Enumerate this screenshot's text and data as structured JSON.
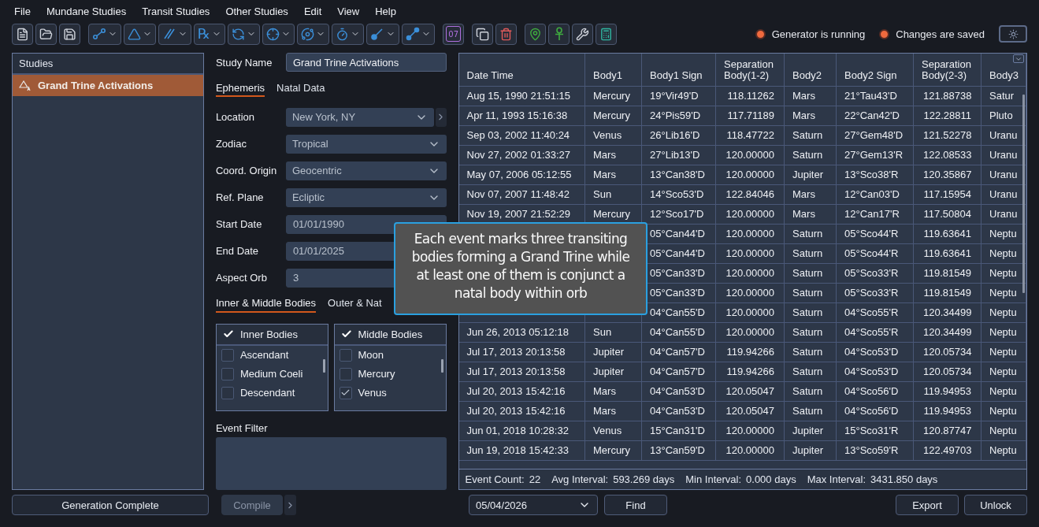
{
  "menu": [
    "File",
    "Mundane Studies",
    "Transit Studies",
    "Other Studies",
    "Edit",
    "View",
    "Help"
  ],
  "toolbar": [
    [
      {
        "kind": "plain"
      },
      {
        "kind": "plain"
      },
      {
        "kind": "plain"
      }
    ],
    [
      {
        "kind": "dropdown"
      },
      {
        "kind": "dropdown"
      },
      {
        "kind": "dropdown"
      },
      {
        "kind": "dropdown",
        "glyph": "℞"
      },
      {
        "kind": "dropdown"
      },
      {
        "kind": "dropdown"
      },
      {
        "kind": "dropdown"
      },
      {
        "kind": "dropdown"
      },
      {
        "kind": "dropdown"
      },
      {
        "kind": "dropdown"
      }
    ],
    [
      {
        "kind": "plain",
        "glyph": "07"
      }
    ],
    [
      {
        "kind": "plain"
      },
      {
        "kind": "plain"
      }
    ],
    [
      {
        "kind": "plain"
      },
      {
        "kind": "plain"
      },
      {
        "kind": "plain"
      },
      {
        "kind": "plain"
      }
    ]
  ],
  "indicators": [
    {
      "label": "Generator is running",
      "on": true
    },
    {
      "label": "Changes are saved",
      "on": true
    }
  ],
  "studies": {
    "title": "Studies",
    "items": [
      {
        "label": "Grand Trine Activations",
        "selected": true
      }
    ]
  },
  "study_name": {
    "label": "Study Name",
    "value": "Grand Trine Activations"
  },
  "tabs": [
    {
      "label": "Ephemeris",
      "selected": true
    },
    {
      "label": "Natal Data",
      "selected": false
    }
  ],
  "fields": [
    {
      "kind": "select",
      "label": "Location",
      "value": "New York, NY",
      "more": true
    },
    {
      "kind": "select",
      "label": "Zodiac",
      "value": "Tropical"
    },
    {
      "kind": "select",
      "label": "Coord. Origin",
      "value": "Geocentric"
    },
    {
      "kind": "select",
      "label": "Ref. Plane",
      "value": "Ecliptic"
    },
    {
      "kind": "text",
      "label": "Start Date",
      "value": "01/01/1990"
    },
    {
      "kind": "text",
      "label": "End Date",
      "value": "01/01/2025"
    },
    {
      "kind": "text",
      "label": "Aspect Orb",
      "value": "3"
    }
  ],
  "body_tabs": [
    {
      "label": "Inner & Middle Bodies",
      "selected": true
    },
    {
      "label": "Outer & Nat",
      "selected": false
    }
  ],
  "body_lists": [
    {
      "title": "Inner Bodies",
      "checked": true,
      "items": [
        {
          "label": "Ascendant",
          "checked": false
        },
        {
          "label": "Medium Coeli",
          "checked": false
        },
        {
          "label": "Descendant",
          "checked": false
        }
      ]
    },
    {
      "title": "Middle Bodies",
      "checked": true,
      "items": [
        {
          "label": "Moon",
          "checked": false
        },
        {
          "label": "Mercury",
          "checked": false
        },
        {
          "label": "Venus",
          "checked": true
        }
      ]
    }
  ],
  "event_filter": {
    "label": "Event Filter"
  },
  "table": {
    "columns": [
      "Date Time",
      "Body1",
      "Body1 Sign",
      "Separation Body(1-2)",
      "Body2",
      "Body2 Sign",
      "Separation Body(2-3)",
      "Body3"
    ],
    "rows": [
      [
        "Aug 15, 1990 21:51:15",
        "Mercury",
        "19°Vir49'D",
        "118.11262",
        "Mars",
        "21°Tau43'D",
        "121.88738",
        "Satur"
      ],
      [
        "Apr 11, 1993 15:16:38",
        "Mercury",
        "24°Pis59'D",
        "117.71189",
        "Mars",
        "22°Can42'D",
        "122.28811",
        "Pluto"
      ],
      [
        "Sep 03, 2002 11:40:24",
        "Venus",
        "26°Lib16'D",
        "118.47722",
        "Saturn",
        "27°Gem48'D",
        "121.52278",
        "Uranu"
      ],
      [
        "Nov 27, 2002 01:33:27",
        "Mars",
        "27°Lib13'D",
        "120.00000",
        "Saturn",
        "27°Gem13'R",
        "122.08533",
        "Uranu"
      ],
      [
        "May 07, 2006 05:12:55",
        "Mars",
        "13°Can38'D",
        "120.00000",
        "Jupiter",
        "13°Sco38'R",
        "120.35867",
        "Uranu"
      ],
      [
        "Nov 07, 2007 11:48:42",
        "Sun",
        "14°Sco53'D",
        "122.84046",
        "Mars",
        "12°Can03'D",
        "117.15954",
        "Uranu"
      ],
      [
        "Nov 19, 2007 21:52:29",
        "Mercury",
        "12°Sco17'D",
        "120.00000",
        "Mars",
        "12°Can17'R",
        "117.50804",
        "Uranu"
      ],
      [
        null,
        null,
        "05°Can44'D",
        "120.00000",
        "Saturn",
        "05°Sco44'R",
        "119.63641",
        "Neptu"
      ],
      [
        null,
        null,
        "05°Can44'D",
        "120.00000",
        "Saturn",
        "05°Sco44'R",
        "119.63641",
        "Neptu"
      ],
      [
        null,
        null,
        "05°Can33'D",
        "120.00000",
        "Saturn",
        "05°Sco33'R",
        "119.81549",
        "Neptu"
      ],
      [
        null,
        null,
        "05°Can33'D",
        "120.00000",
        "Saturn",
        "05°Sco33'R",
        "119.81549",
        "Neptu"
      ],
      [
        null,
        null,
        "04°Can55'D",
        "120.00000",
        "Saturn",
        "04°Sco55'R",
        "120.34499",
        "Neptu"
      ],
      [
        "Jun 26, 2013 05:12:18",
        "Sun",
        "04°Can55'D",
        "120.00000",
        "Saturn",
        "04°Sco55'R",
        "120.34499",
        "Neptu"
      ],
      [
        "Jul 17, 2013 20:13:58",
        "Jupiter",
        "04°Can57'D",
        "119.94266",
        "Saturn",
        "04°Sco53'D",
        "120.05734",
        "Neptu"
      ],
      [
        "Jul 17, 2013 20:13:58",
        "Jupiter",
        "04°Can57'D",
        "119.94266",
        "Saturn",
        "04°Sco53'D",
        "120.05734",
        "Neptu"
      ],
      [
        "Jul 20, 2013 15:42:16",
        "Mars",
        "04°Can53'D",
        "120.05047",
        "Saturn",
        "04°Sco56'D",
        "119.94953",
        "Neptu"
      ],
      [
        "Jul 20, 2013 15:42:16",
        "Mars",
        "04°Can53'D",
        "120.05047",
        "Saturn",
        "04°Sco56'D",
        "119.94953",
        "Neptu"
      ],
      [
        "Jun 01, 2018 10:28:32",
        "Venus",
        "15°Can31'D",
        "120.00000",
        "Jupiter",
        "15°Sco31'R",
        "120.87747",
        "Neptu"
      ],
      [
        "Jun 19, 2018 15:42:33",
        "Mercury",
        "13°Can59'D",
        "120.00000",
        "Jupiter",
        "13°Sco59'R",
        "122.49703",
        "Neptu"
      ]
    ]
  },
  "stats": [
    {
      "label": "Event Count:",
      "value": "22"
    },
    {
      "label": "Avg Interval:",
      "value": "593.269 days"
    },
    {
      "label": "Min Interval:",
      "value": "0.000 days"
    },
    {
      "label": "Max Interval:",
      "value": "3431.850 days"
    }
  ],
  "bottom": {
    "status_button": "Generation Complete",
    "compile_button": "Compile",
    "compile_disabled": true,
    "date": "05/04/2026",
    "find_button": "Find",
    "export_button": "Export",
    "unlock_button": "Unlock"
  },
  "tooltip": "Each event marks three transiting bodies forming a Grand Trine while at least one of them is conjunct a natal body within orb"
}
